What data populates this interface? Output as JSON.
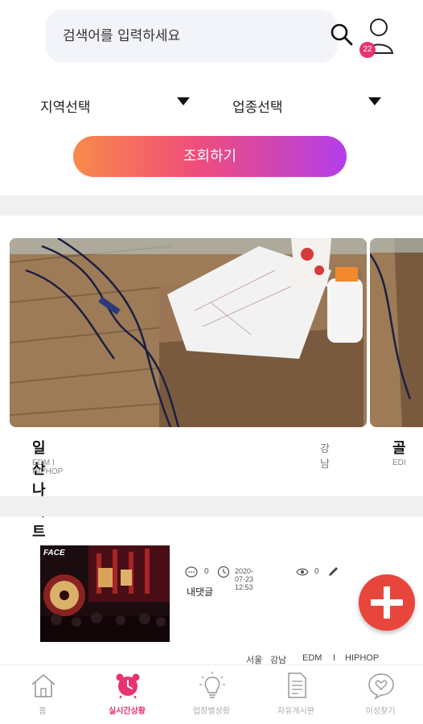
{
  "search": {
    "placeholder": "검색어를 입력하세요",
    "notification_count": "22"
  },
  "filters": {
    "region": {
      "label": "지역선택"
    },
    "business_type": {
      "label": "업종선택"
    },
    "submit_label": "조회하기"
  },
  "carousel": {
    "cards": [
      {
        "title": "일산 나이트",
        "region": "강남",
        "genres": "EDM I HIPHOP"
      },
      {
        "title": "골",
        "genres": "EDI"
      }
    ]
  },
  "post": {
    "comments": "0",
    "datetime": "2020-07-23 12:53",
    "views": "0",
    "text": "내댓글",
    "thumb_logo": "FACE",
    "tags": [
      "서울",
      "강남",
      "EDM",
      "I",
      "HIPHOP"
    ]
  },
  "bottom_nav": {
    "items": [
      {
        "label": "홈",
        "icon": "home-icon"
      },
      {
        "label": "실시간상황",
        "icon": "alarm-clock-icon",
        "active": true
      },
      {
        "label": "업장별상황",
        "icon": "lightbulb-icon"
      },
      {
        "label": "자유게시판",
        "icon": "document-icon"
      },
      {
        "label": "이성찾기",
        "icon": "heart-bubble-icon"
      }
    ]
  },
  "colors": {
    "accent": "#e8336e",
    "fab": "#e8453c",
    "gradient_start": "#f98a4a",
    "gradient_end": "#b23ee9"
  }
}
